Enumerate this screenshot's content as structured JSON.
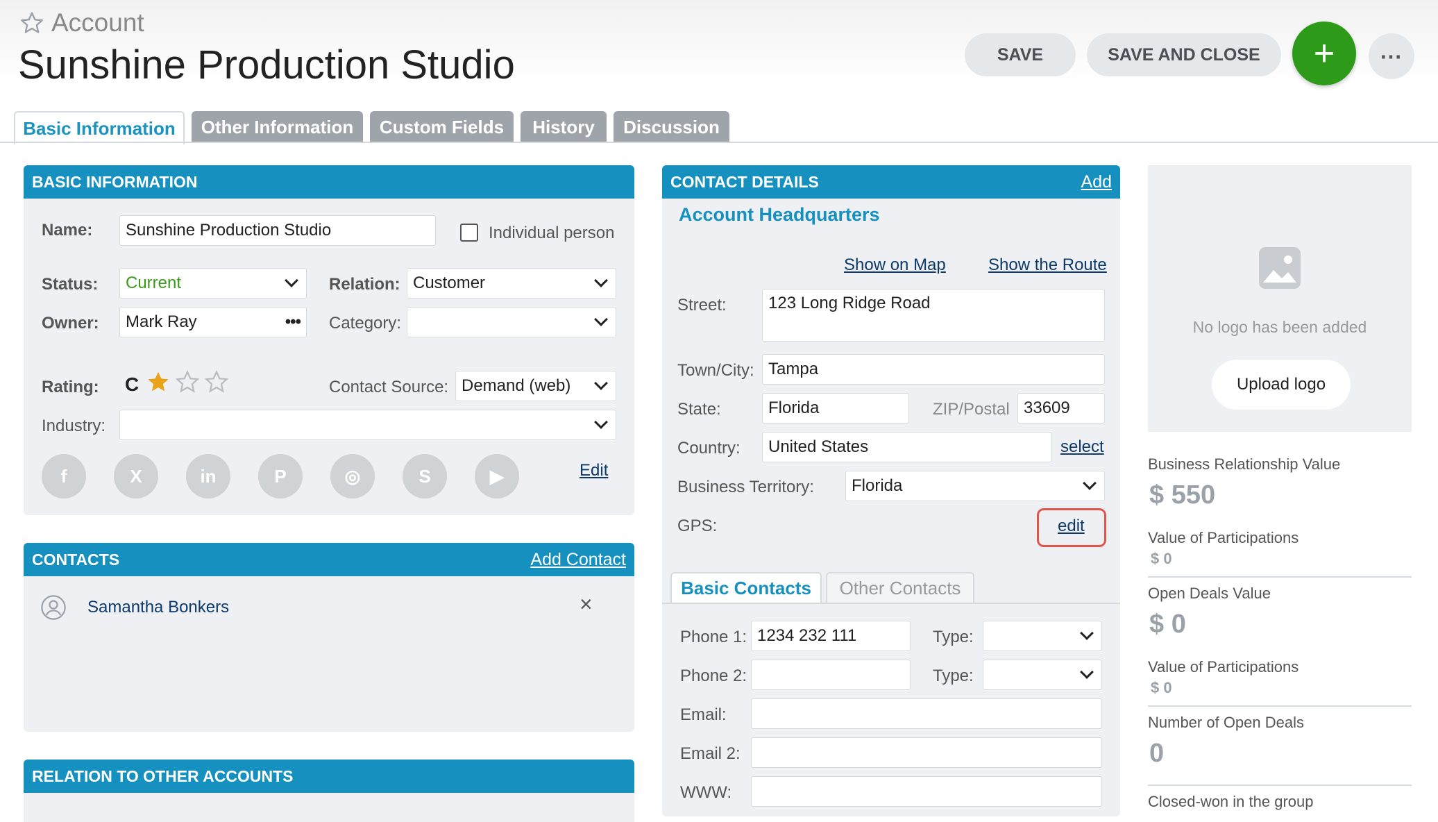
{
  "header": {
    "entity_label": "Account",
    "title": "Sunshine Production Studio",
    "save_label": "SAVE",
    "save_close_label": "SAVE AND CLOSE",
    "add_symbol": "+",
    "more_symbol": "⋯"
  },
  "tabs": [
    "Basic Information",
    "Other Information",
    "Custom Fields",
    "History",
    "Discussion"
  ],
  "basic_info": {
    "heading": "BASIC INFORMATION",
    "name_label": "Name:",
    "name_value": "Sunshine Production Studio",
    "individual_label": "Individual person",
    "status_label": "Status:",
    "status_value": "Current",
    "relation_label": "Relation:",
    "relation_value": "Customer",
    "owner_label": "Owner:",
    "owner_value": "Mark Ray",
    "owner_more": "•••",
    "category_label": "Category:",
    "category_value": "",
    "rating_label": "Rating:",
    "rating_value": "C",
    "rating_stars": 1,
    "rating_max": 3,
    "contact_source_label": "Contact Source:",
    "contact_source_value": "Demand (web)",
    "industry_label": "Industry:",
    "industry_value": "",
    "social_icons": [
      "facebook-icon",
      "x-icon",
      "linkedin-icon",
      "pinterest-icon",
      "instagram-icon",
      "skype-icon",
      "youtube-icon"
    ],
    "social_glyphs": [
      "f",
      "X",
      "in",
      "P",
      "◎",
      "S",
      "▶"
    ],
    "edit_label": "Edit"
  },
  "contacts": {
    "heading": "CONTACTS",
    "add_label": "Add Contact",
    "items": [
      {
        "name": "Samantha Bonkers"
      }
    ],
    "remove_symbol": "×"
  },
  "relation": {
    "heading": "RELATION TO OTHER ACCOUNTS"
  },
  "contact_details": {
    "heading": "CONTACT DETAILS",
    "add_label": "Add",
    "section_title": "Account Headquarters",
    "show_map": "Show on Map",
    "show_route": "Show the Route",
    "street_label": "Street:",
    "street_value": "123 Long Ridge Road",
    "city_label": "Town/City:",
    "city_value": "Tampa",
    "state_label": "State:",
    "state_value": "Florida",
    "zip_label": "ZIP/Postal",
    "zip_value": "33609",
    "country_label": "Country:",
    "country_value": "United States",
    "select_label": "select",
    "territory_label": "Business Territory:",
    "territory_value": "Florida",
    "gps_label": "GPS:",
    "gps_edit": "edit",
    "subtabs": [
      "Basic Contacts",
      "Other Contacts"
    ],
    "phone1_label": "Phone 1:",
    "phone1_value": "1234 232 111",
    "phone2_label": "Phone 2:",
    "phone2_value": "",
    "type_label": "Type:",
    "email_label": "Email:",
    "email2_label": "Email 2:",
    "www_label": "WWW:"
  },
  "logo": {
    "no_logo_text": "No logo has been added",
    "upload_label": "Upload logo"
  },
  "stats": [
    {
      "label": "Business Relationship Value",
      "value": "$ 550",
      "size": "big"
    },
    {
      "label": "Value of Participations",
      "value": "$ 0",
      "size": "small"
    },
    {
      "label": "Open Deals Value",
      "value": "$ 0",
      "size": "big"
    },
    {
      "label": "Value of Participations",
      "value": "$ 0",
      "size": "small"
    },
    {
      "label": "Number of Open Deals",
      "value": "0",
      "size": "big"
    },
    {
      "label": "Closed-won in the group",
      "value": "",
      "size": "big"
    }
  ],
  "colors": {
    "accent": "#1590bf",
    "status_current": "#3a9a1a",
    "add_button": "#2e9a1a",
    "star": "#e8a317",
    "highlight": "#e0574a"
  }
}
